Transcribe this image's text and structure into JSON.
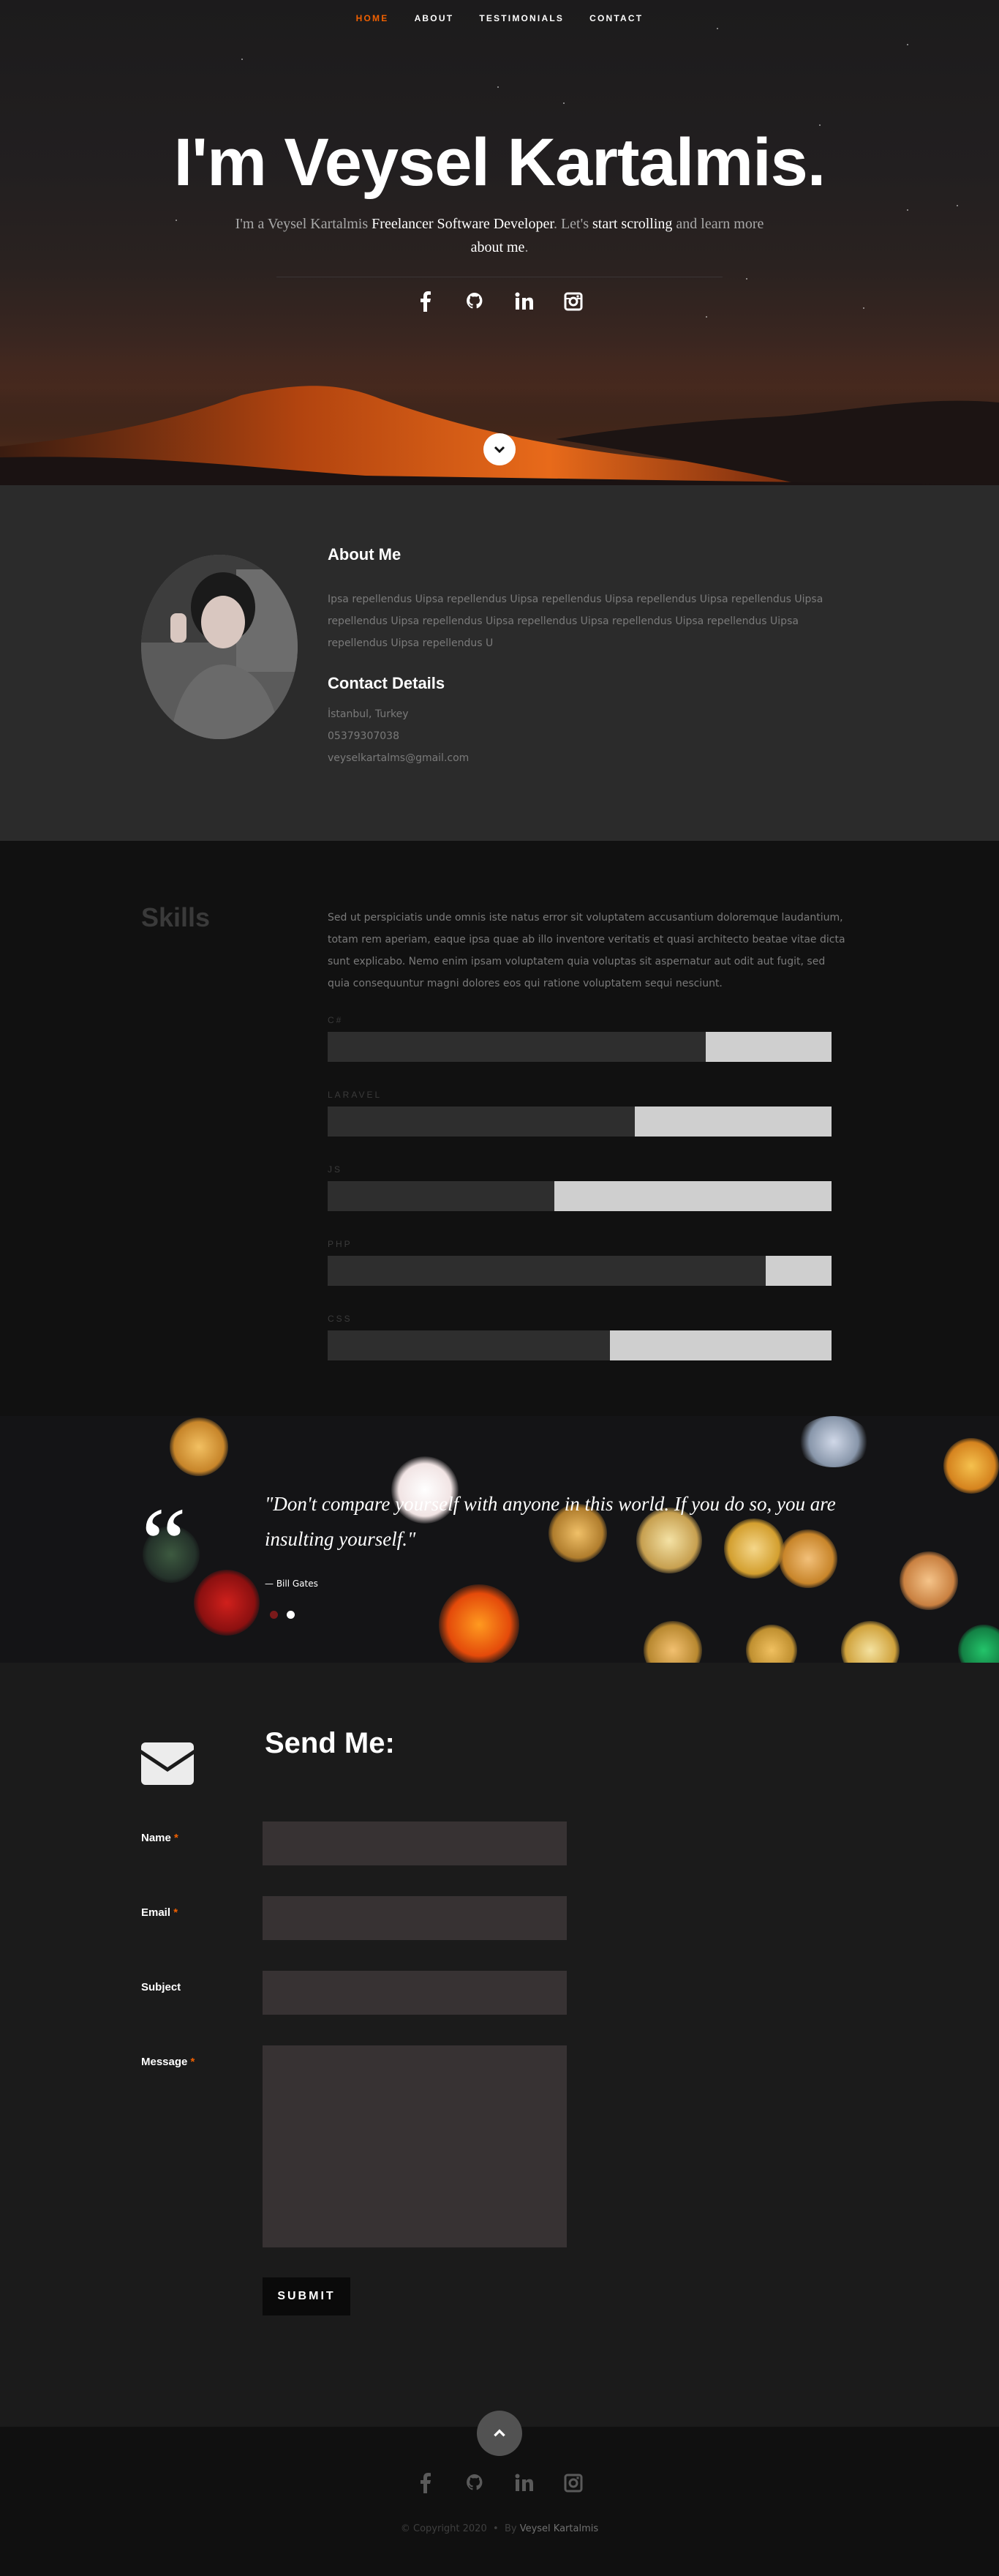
{
  "nav": {
    "items": [
      {
        "label": "HOME",
        "active": true
      },
      {
        "label": "ABOUT"
      },
      {
        "label": "TESTIMONIALS"
      },
      {
        "label": "CONTACT"
      }
    ]
  },
  "hero": {
    "title": "I'm Veysel Kartalmis.",
    "text_prefix": "I'm a Veysel Kartalmis ",
    "role": "Freelancer Software Developer",
    "text_mid": ". Let's ",
    "cta_scroll": "start scrolling",
    "text_and": " and learn more ",
    "cta_about": "about me",
    "text_end": ".",
    "social_icons": [
      "facebook-icon",
      "github-icon",
      "linkedin-icon",
      "instagram-icon"
    ]
  },
  "about": {
    "heading": "About Me",
    "text": "Ipsa repellendus Uipsa repellendus Uipsa repellendus Uipsa repellendus Uipsa repellendus Uipsa repellendus Uipsa repellendus Uipsa repellendus Uipsa repellendus Uipsa repellendus Uipsa repellendus Uipsa repellendus U",
    "contact_heading": "Contact Details",
    "location": "İstanbul, Turkey",
    "phone": "05379307038",
    "email": "veyselkartalms@gmail.com"
  },
  "skills": {
    "heading": "Skills",
    "text": "Sed ut perspiciatis unde omnis iste natus error sit voluptatem accusantium doloremque laudantium, totam rem aperiam, eaque ipsa quae ab illo inventore veritatis et quasi architecto beatae vitae dicta sunt explicabo. Nemo enim ipsam voluptatem quia voluptas sit aspernatur aut odit aut fugit, sed quia consequuntur magni dolores eos qui ratione voluptatem sequi nesciunt.",
    "items": [
      {
        "label": "C#",
        "percent": 75
      },
      {
        "label": "LARAVEL",
        "percent": 61
      },
      {
        "label": "JS",
        "percent": 45
      },
      {
        "label": "PHP",
        "percent": 87
      },
      {
        "label": "CSS",
        "percent": 56
      }
    ]
  },
  "testimonial": {
    "quote": "\"Don't compare yourself with anyone in this world. If you do so, you are insulting yourself.\"",
    "author": "— Bill Gates",
    "slides": 2,
    "active_slide": 2
  },
  "contact": {
    "title": "Send Me:",
    "fields": {
      "name": "Name",
      "email": "Email",
      "subject": "Subject",
      "message": "Message"
    },
    "required_mark": "*",
    "submit": "SUBMIT"
  },
  "footer": {
    "copyright": "© Copyright 2020",
    "separator": "•",
    "by_prefix": "By",
    "author": "Veysel Kartalmis",
    "social_icons": [
      "facebook-icon",
      "github-icon",
      "linkedin-icon",
      "instagram-icon"
    ]
  },
  "colors": {
    "accent": "#f06000",
    "dark": "#111111",
    "panel": "#2b2b2b",
    "input": "#373233"
  }
}
